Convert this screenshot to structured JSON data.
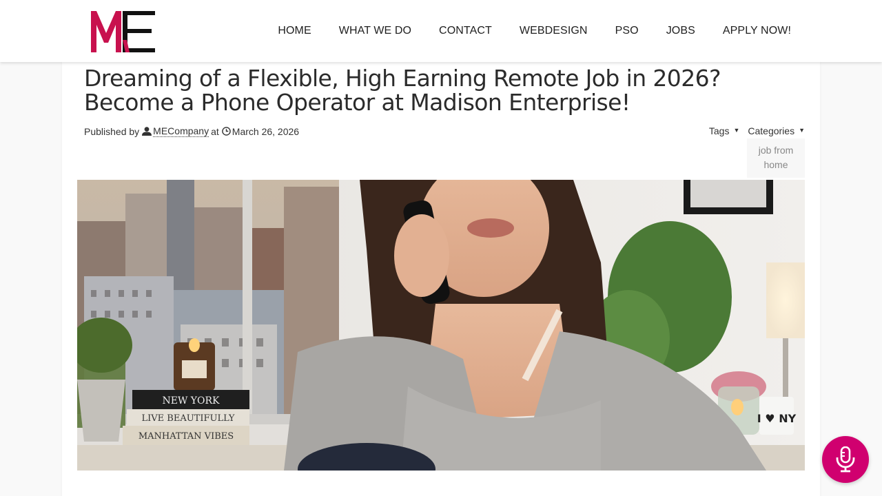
{
  "brand": {
    "logo_text": "ME",
    "accent": "#c8114e"
  },
  "nav": {
    "items": [
      {
        "label": "HOME"
      },
      {
        "label": "WHAT WE DO"
      },
      {
        "label": "CONTACT"
      },
      {
        "label": "WEBDESIGN"
      },
      {
        "label": "PSO"
      },
      {
        "label": "JOBS"
      },
      {
        "label": "APPLY NOW!"
      }
    ]
  },
  "post": {
    "title": "Dreaming of a Flexible, High Earning Remote Job in 2026? Become a Phone Operator at Madison Enterprise!",
    "published_by": "Published by",
    "author": "MECompany",
    "at": "at",
    "date": "March 26, 2026",
    "tags_label": "Tags",
    "categories_label": "Categories",
    "categories": [
      "job from home"
    ],
    "image_text": {
      "book1": "NEW YORK",
      "book2": "LIVE BEAUTIFULLY",
      "book3": "MANHATTAN VIBES",
      "mug": "I ♥ NY"
    }
  },
  "fab": {
    "icon": "microphone-icon",
    "color": "#d0006f"
  }
}
